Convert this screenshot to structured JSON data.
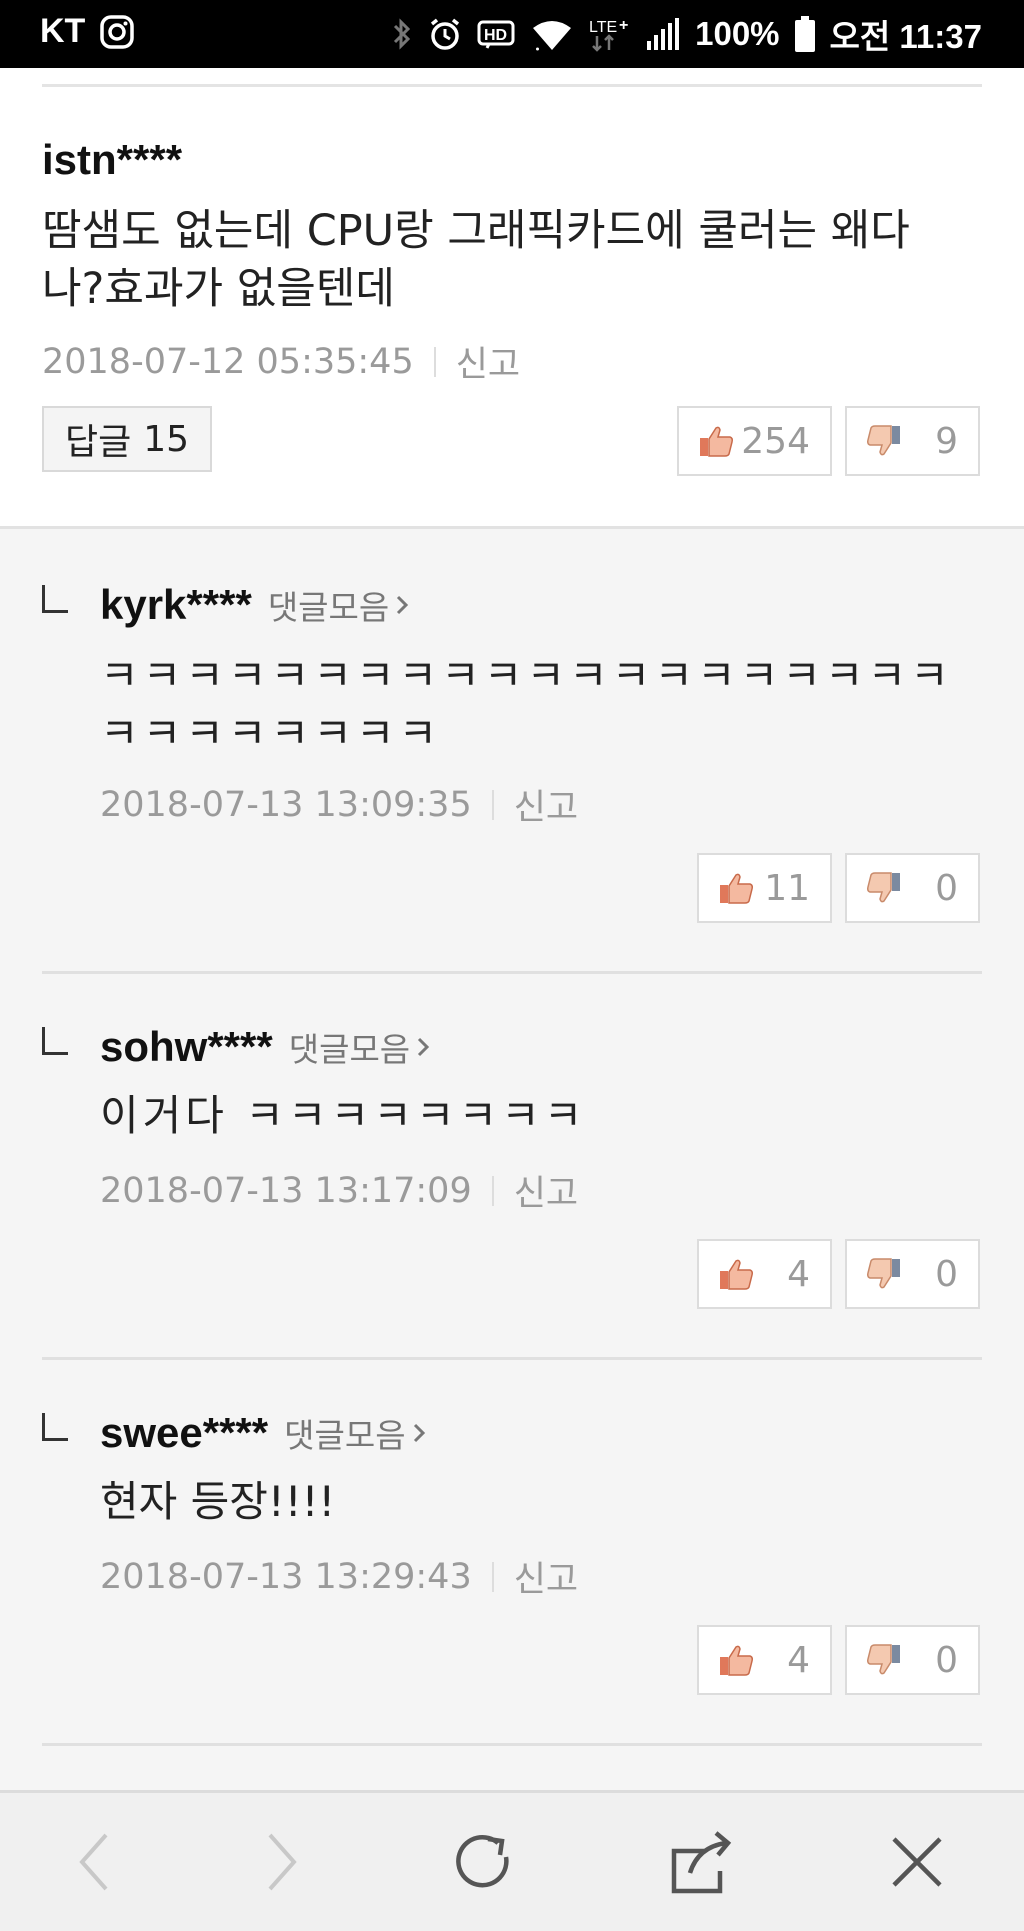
{
  "status_bar": {
    "carrier": "KT",
    "battery": "100%",
    "time": "오전 11:37",
    "icons": [
      "instagram-icon",
      "bluetooth-icon",
      "alarm-icon",
      "hd-icon",
      "wifi-icon",
      "lte-icon",
      "signal-icon",
      "battery-icon"
    ]
  },
  "main_comment": {
    "username": "istn****",
    "body": "땀샘도 없는데 CPU랑 그래픽카드에 쿨러는 왜다나?효과가 없을텐데",
    "timestamp": "2018-07-12 05:35:45",
    "report": "신고",
    "reply_label": "답글",
    "reply_count": "15",
    "likes": "254",
    "dislikes": "9"
  },
  "replies": [
    {
      "username": "kyrk****",
      "collect": "댓글모음",
      "text": "ㅋㅋㅋㅋㅋㅋㅋㅋㅋㅋㅋㅋㅋㅋㅋㅋㅋㅋㅋㅋㅋㅋㅋㅋㅋㅋㅋㅋ",
      "timestamp": "2018-07-13 13:09:35",
      "report": "신고",
      "likes": "11",
      "dislikes": "0"
    },
    {
      "username": "sohw****",
      "collect": "댓글모음",
      "text": "이거다 ㅋㅋㅋㅋㅋㅋㅋㅋ",
      "timestamp": "2018-07-13 13:17:09",
      "report": "신고",
      "likes": "4",
      "dislikes": "0"
    },
    {
      "username": "swee****",
      "collect": "댓글모음",
      "text": "현자 등장!!!!",
      "timestamp": "2018-07-13 13:29:43",
      "report": "신고",
      "likes": "4",
      "dislikes": "0"
    }
  ],
  "bottom_nav": {
    "icons": [
      "back-icon",
      "forward-icon",
      "refresh-icon",
      "share-icon",
      "close-icon"
    ]
  }
}
